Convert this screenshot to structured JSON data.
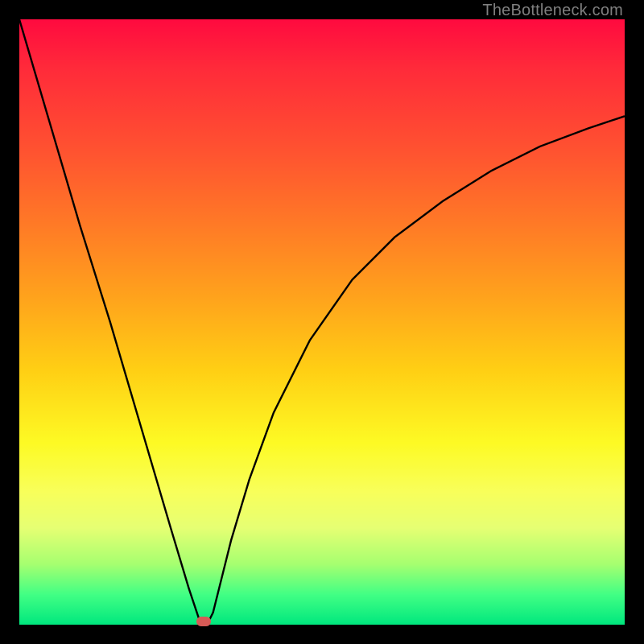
{
  "attribution": "TheBottleneck.com",
  "colors": {
    "frame": "#000000",
    "curve": "#000000",
    "marker": "#d65a56",
    "attribution_text": "#7f7f7f"
  },
  "chart_data": {
    "type": "line",
    "title": "",
    "xlabel": "",
    "ylabel": "",
    "xlim": [
      0,
      100
    ],
    "ylim": [
      0,
      100
    ],
    "series": [
      {
        "name": "bottleneck-curve",
        "x": [
          0,
          5,
          10,
          15,
          20,
          25,
          28,
          30,
          31,
          32,
          33,
          35,
          38,
          42,
          48,
          55,
          62,
          70,
          78,
          86,
          94,
          100
        ],
        "values": [
          100,
          83,
          66,
          50,
          33,
          16,
          6,
          0,
          0,
          2,
          6,
          14,
          24,
          35,
          47,
          57,
          64,
          70,
          75,
          79,
          82,
          84
        ]
      }
    ],
    "marker": {
      "x": 30.5,
      "y": 0.5
    },
    "annotations": []
  }
}
